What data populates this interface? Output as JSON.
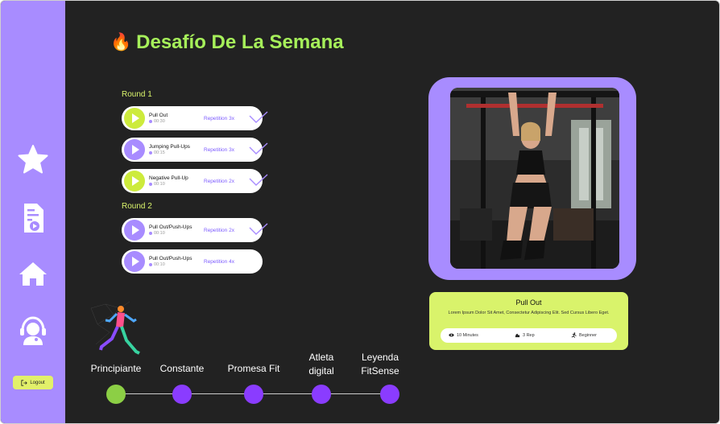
{
  "header": {
    "title": "Desafío De La Semana",
    "icon": "fire-icon"
  },
  "sidebar": {
    "icons": [
      "star-icon",
      "video-document-icon",
      "home-icon",
      "support-agent-icon"
    ],
    "logout_label": "Logout"
  },
  "rounds": [
    {
      "label": "Round 1",
      "exercises": [
        {
          "name": "Pull Out",
          "time": "00:30",
          "reps": "Repetition 3x",
          "play_color": "green",
          "checked": true
        },
        {
          "name": "Jumping Pull-Ups",
          "time": "00:15",
          "reps": "Repetition 3x",
          "play_color": "purple",
          "checked": true
        },
        {
          "name": "Negative Pull-Up",
          "time": "00:10",
          "reps": "Repetition 2x",
          "play_color": "green",
          "checked": true
        }
      ]
    },
    {
      "label": "Round 2",
      "exercises": [
        {
          "name": "Pull Out/Push-Ups",
          "time": "00:10",
          "reps": "Repetition 2x",
          "play_color": "purple",
          "checked": true
        },
        {
          "name": "Pull Out/Push-Ups",
          "time": "00:10",
          "reps": "Repetition 4x",
          "play_color": "purple",
          "checked": false
        }
      ]
    }
  ],
  "detail": {
    "title": "Pull Out",
    "description": "Lorem Ipsum Dolor Sit Amet, Consectetur Adipiscing Elit. Sed Cursus Libero Eget.",
    "duration": "10 Minutes",
    "reps": "3 Rep",
    "level": "Beginner"
  },
  "levels": [
    {
      "label": "Principiante",
      "active": true
    },
    {
      "label": "Constante",
      "active": false
    },
    {
      "label": "Promesa Fit",
      "active": false
    },
    {
      "label": "Atleta digital",
      "active": false
    },
    {
      "label": "Leyenda FitSense",
      "active": false
    }
  ],
  "colors": {
    "background": "#222222",
    "sidebar": "#a88cff",
    "accent_green": "#a6f05a",
    "accent_lime": "#d9f36b",
    "accent_purple": "#8a3cff"
  }
}
